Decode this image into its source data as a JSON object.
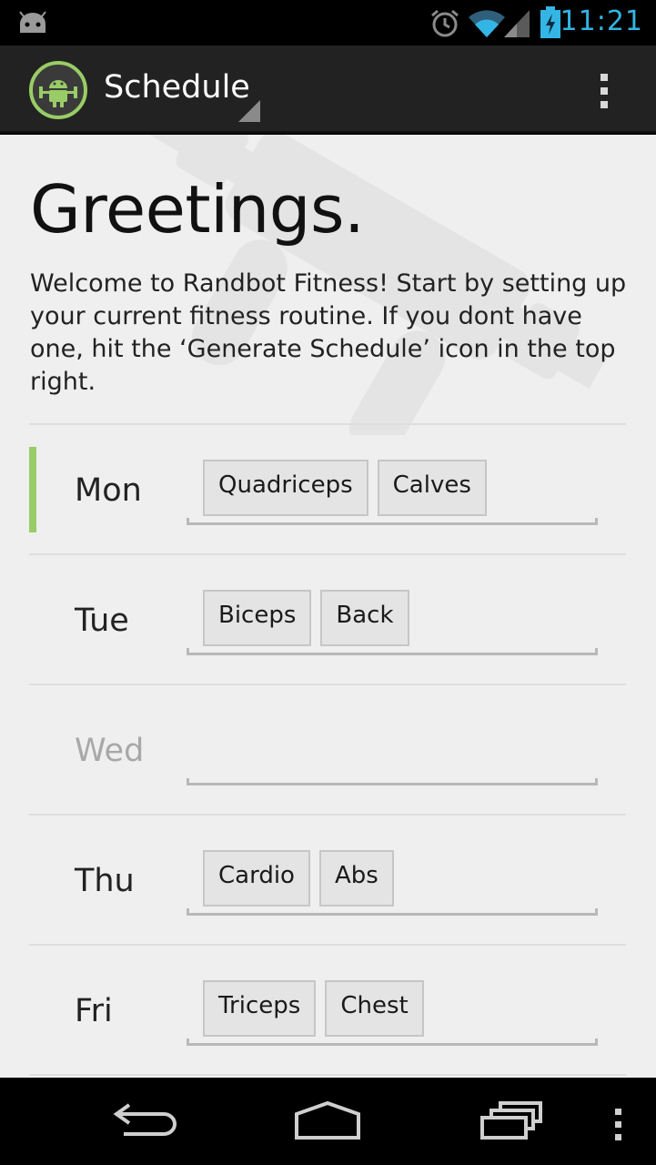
{
  "status_bar": {
    "time": "11:21",
    "icons": [
      "android-notification-icon",
      "alarm-icon",
      "wifi-icon",
      "signal-icon",
      "battery-charging-icon"
    ],
    "accent_color": "#33b5e5"
  },
  "action_bar": {
    "title": "Schedule",
    "logo_icon": "android-dumbbell-logo-icon",
    "overflow_icon": "overflow-menu-icon"
  },
  "content": {
    "greeting": "Greetings.",
    "intro": "Welcome to Randbot Fitness! Start by setting up your current fitness routine. If you dont have one, hit the ‘Generate Schedule’ icon in the top right.",
    "days": [
      {
        "name": "Mon",
        "muscles": [
          "Quadriceps",
          "Calves"
        ],
        "selected": true
      },
      {
        "name": "Tue",
        "muscles": [
          "Biceps",
          "Back"
        ],
        "selected": false
      },
      {
        "name": "Wed",
        "muscles": [],
        "selected": false
      },
      {
        "name": "Thu",
        "muscles": [
          "Cardio",
          "Abs"
        ],
        "selected": false
      },
      {
        "name": "Fri",
        "muscles": [
          "Triceps",
          "Chest"
        ],
        "selected": false
      }
    ],
    "selected_indicator_color": "#99cc66"
  },
  "nav_bar": {
    "buttons": [
      "back-icon",
      "home-icon",
      "recent-apps-icon",
      "menu-icon"
    ]
  }
}
